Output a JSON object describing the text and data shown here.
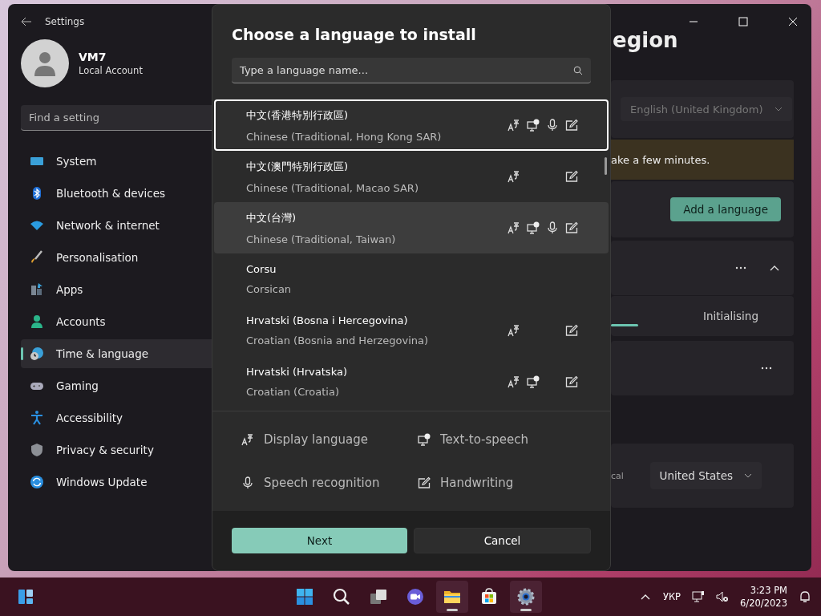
{
  "window": {
    "title": "Settings"
  },
  "account": {
    "name": "VM7",
    "type": "Local Account"
  },
  "search": {
    "placeholder": "Find a setting"
  },
  "sidebar": {
    "items": [
      {
        "label": "System",
        "kind": "system",
        "selected": false
      },
      {
        "label": "Bluetooth & devices",
        "kind": "bluetooth",
        "selected": false
      },
      {
        "label": "Network & internet",
        "kind": "network",
        "selected": false
      },
      {
        "label": "Personalisation",
        "kind": "brush",
        "selected": false
      },
      {
        "label": "Apps",
        "kind": "apps",
        "selected": false
      },
      {
        "label": "Accounts",
        "kind": "accounts",
        "selected": false
      },
      {
        "label": "Time & language",
        "kind": "time",
        "selected": true
      },
      {
        "label": "Gaming",
        "kind": "gaming",
        "selected": false
      },
      {
        "label": "Accessibility",
        "kind": "accessibility",
        "selected": false
      },
      {
        "label": "Privacy & security",
        "kind": "privacy",
        "selected": false
      },
      {
        "label": "Windows Update",
        "kind": "update",
        "selected": false
      }
    ]
  },
  "content": {
    "title": "egion",
    "display_language": "English (United Kingdom)",
    "notice": "ake a few minutes.",
    "add_button": "Add a language",
    "status": "Initialising",
    "progress": {
      "level": 0.15
    },
    "region_label": "cal",
    "region_value": "United States"
  },
  "dialog": {
    "title": "Choose a language to install",
    "search": {
      "placeholder": "Type a language name..."
    },
    "languages": [
      {
        "native": "中文(香港特別行政區)",
        "english": "Chinese (Traditional, Hong Kong SAR)",
        "selected": true,
        "hovered": false,
        "display": true,
        "tts": true,
        "speech": true,
        "handwriting": true
      },
      {
        "native": "中文(澳門特別行政區)",
        "english": "Chinese (Traditional, Macao SAR)",
        "selected": false,
        "hovered": false,
        "display": true,
        "tts": false,
        "speech": false,
        "handwriting": true
      },
      {
        "native": "中文(台灣)",
        "english": "Chinese (Traditional, Taiwan)",
        "selected": false,
        "hovered": true,
        "display": true,
        "tts": true,
        "speech": true,
        "handwriting": true
      },
      {
        "native": "Corsu",
        "english": "Corsican",
        "selected": false,
        "hovered": false,
        "display": false,
        "tts": false,
        "speech": false,
        "handwriting": false
      },
      {
        "native": "Hrvatski (Bosna i Hercegovina)",
        "english": "Croatian (Bosnia and Herzegovina)",
        "selected": false,
        "hovered": false,
        "display": true,
        "tts": false,
        "speech": false,
        "handwriting": true
      },
      {
        "native": "Hrvatski (Hrvatska)",
        "english": "Croatian (Croatia)",
        "selected": false,
        "hovered": false,
        "display": true,
        "tts": true,
        "speech": false,
        "handwriting": true
      }
    ],
    "legend": [
      {
        "kind": "display",
        "label": "Display language"
      },
      {
        "kind": "tts",
        "label": "Text-to-speech"
      },
      {
        "kind": "speech",
        "label": "Speech recognition"
      },
      {
        "kind": "handwriting",
        "label": "Handwriting"
      }
    ],
    "buttons": [
      {
        "label": "Next",
        "kind": "primary"
      },
      {
        "label": "Cancel",
        "kind": "secondary"
      }
    ]
  },
  "taskbar": {
    "apps": [
      {
        "kind": "widgets",
        "active": false
      },
      {
        "kind": "start",
        "active": false
      },
      {
        "kind": "search",
        "active": false
      },
      {
        "kind": "taskview",
        "active": false
      },
      {
        "kind": "meet",
        "active": false
      },
      {
        "kind": "explorer",
        "active": true
      },
      {
        "kind": "store",
        "active": false
      },
      {
        "kind": "settings",
        "active": true
      }
    ],
    "language": "УКР",
    "time": "3:23 PM",
    "date": "6/20/2023"
  }
}
